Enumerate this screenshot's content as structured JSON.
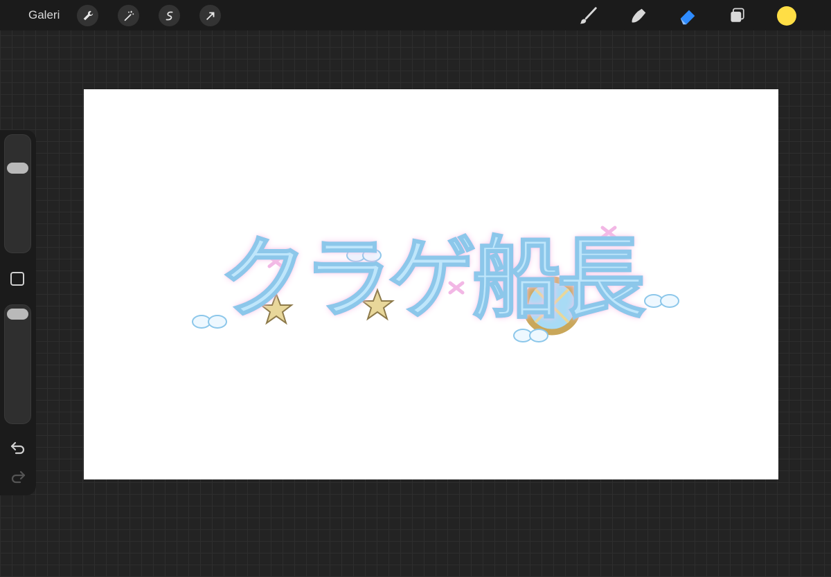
{
  "topbar": {
    "gallery_label": "Galeri",
    "left_tools": [
      {
        "icon": "wrench-icon",
        "name": "actions-button"
      },
      {
        "icon": "magic-wand-icon",
        "name": "adjustments-button"
      },
      {
        "icon": "selection-s-icon",
        "name": "selection-button"
      },
      {
        "icon": "arrow-cursor-icon",
        "name": "transform-button"
      }
    ],
    "right_tools": [
      {
        "icon": "brush-icon",
        "name": "brush-tool"
      },
      {
        "icon": "smudge-icon",
        "name": "smudge-tool"
      },
      {
        "icon": "eraser-icon",
        "name": "eraser-tool",
        "active": true
      },
      {
        "icon": "layers-icon",
        "name": "layers-button"
      }
    ],
    "current_color": "#FFDE45",
    "active_tool_color": "#2f8cff"
  },
  "canvas": {
    "artwork_text": "クラゲ船長",
    "artwork_colors": {
      "fill": "#bfe6fb",
      "outline": "#8cc7ea",
      "glow": "#f6c6ea",
      "stars": "#e8d79a"
    }
  },
  "sidebar": {
    "brush_size_level": 0.9,
    "opacity_level": 1.0
  }
}
